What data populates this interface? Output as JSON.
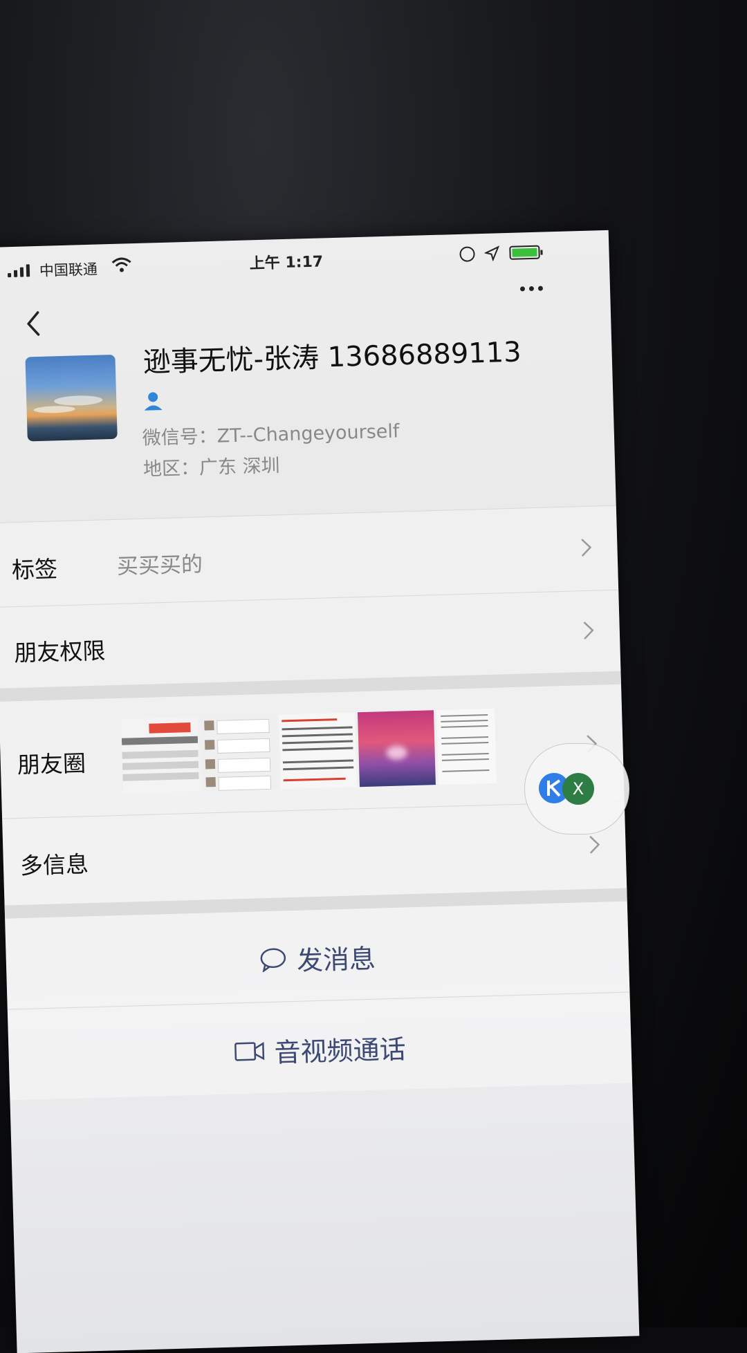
{
  "status_bar": {
    "carrier": "中国联通",
    "time": "上午 1:17"
  },
  "profile": {
    "name": "逊事无忧-张涛 13686889113",
    "wechat_id": "微信号：ZT--Changeyourself",
    "region": "地区：广东 深圳"
  },
  "rows": {
    "tags": {
      "label": "标签",
      "value": "买买买的"
    },
    "friend_permissions": {
      "label": "朋友权限"
    },
    "moments": {
      "label": "朋友圈"
    },
    "more_info": {
      "label": "多信息"
    }
  },
  "floating": {
    "x_label": "X"
  },
  "actions": {
    "message": "发消息",
    "call": "音视频通话"
  },
  "colors": {
    "action_text": "#3c4a72",
    "battery_fill": "#3cbf3c",
    "chat_bubble_x": "#2d7d45",
    "k_icon": "#2f7ee8"
  }
}
